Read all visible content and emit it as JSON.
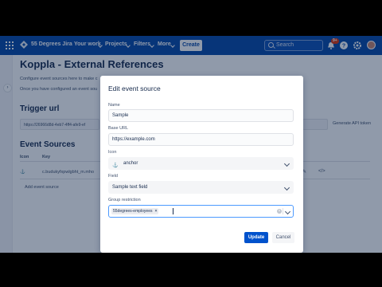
{
  "nav": {
    "brand": "55 Degrees Jira",
    "items": [
      "Your work",
      "Projects",
      "Filters",
      "More"
    ],
    "create_label": "Create",
    "search_placeholder": "Search",
    "notification_count": "9+"
  },
  "page": {
    "title": "Koppla - External References",
    "desc1": "Configure event sources here to make c",
    "desc2": "Once you have configured an event sou",
    "trigger_heading": "Trigger url",
    "trigger_url": "https://26966d8d-4eb7-4ff4-afe9-ef",
    "generate_label": "Generate API token",
    "sources_heading": "Event Sources",
    "col_icon": "Icon",
    "col_key": "Key",
    "row_key": "c.budukyfxpwlgbht_m.mho",
    "add_source": "Add event source"
  },
  "modal": {
    "title": "Edit event source",
    "name_label": "Name",
    "name_value": "Sample",
    "base_url_label": "Base URL",
    "base_url_value": "https://example.com",
    "icon_label": "Icon",
    "icon_value": "anchor",
    "field_label": "Field",
    "field_value": "Sample text field",
    "group_label": "Group restriction",
    "group_tag": "55degrees-employees",
    "update_label": "Update",
    "cancel_label": "Cancel"
  }
}
